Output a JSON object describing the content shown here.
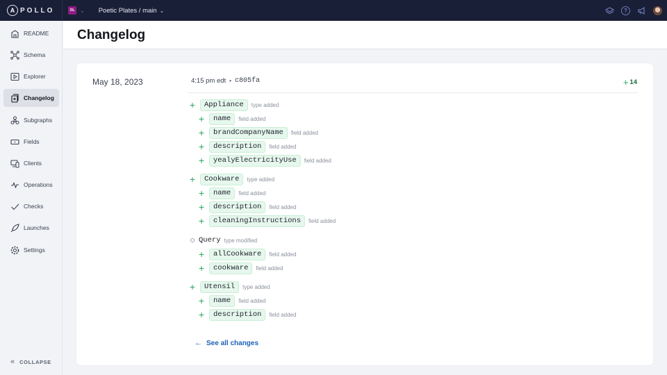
{
  "topbar": {
    "logo_letter": "A",
    "logo_text": "POLLO",
    "org_initials": "OL",
    "graph_name": "Poetic Plates / main",
    "icons": [
      "layers-icon",
      "help-icon",
      "megaphone-icon",
      "avatar"
    ]
  },
  "sidebar": {
    "items": [
      {
        "label": "README",
        "icon": "readme-icon",
        "active": false
      },
      {
        "label": "Schema",
        "icon": "schema-icon",
        "active": false
      },
      {
        "label": "Explorer",
        "icon": "explorer-icon",
        "active": false
      },
      {
        "label": "Changelog",
        "icon": "changelog-icon",
        "active": true
      },
      {
        "label": "Subgraphs",
        "icon": "subgraphs-icon",
        "active": false
      },
      {
        "label": "Fields",
        "icon": "fields-icon",
        "active": false
      },
      {
        "label": "Clients",
        "icon": "clients-icon",
        "active": false
      },
      {
        "label": "Operations",
        "icon": "operations-icon",
        "active": false
      },
      {
        "label": "Checks",
        "icon": "checks-icon",
        "active": false
      },
      {
        "label": "Launches",
        "icon": "launches-icon",
        "active": false
      },
      {
        "label": "Settings",
        "icon": "settings-icon",
        "active": false
      }
    ],
    "collapse_label": "COLLAPSE"
  },
  "page": {
    "title": "Changelog"
  },
  "changelog": {
    "date": "May 18, 2023",
    "time": "4:15 pm edt",
    "separator": "•",
    "commit": "c805fa",
    "change_count": "14",
    "changes": [
      {
        "level": 0,
        "kind": "added",
        "name": "Appliance",
        "label": "type added"
      },
      {
        "level": 1,
        "kind": "added",
        "name": "name",
        "label": "field added"
      },
      {
        "level": 1,
        "kind": "added",
        "name": "brandCompanyName",
        "label": "field added"
      },
      {
        "level": 1,
        "kind": "added",
        "name": "description",
        "label": "field added"
      },
      {
        "level": 1,
        "kind": "added",
        "name": "yealyElectricityUse",
        "label": "field added"
      },
      {
        "level": 0,
        "kind": "added",
        "name": "Cookware",
        "label": "type added"
      },
      {
        "level": 1,
        "kind": "added",
        "name": "name",
        "label": "field added"
      },
      {
        "level": 1,
        "kind": "added",
        "name": "description",
        "label": "field added"
      },
      {
        "level": 1,
        "kind": "added",
        "name": "cleaningInstructions",
        "label": "field added"
      },
      {
        "level": 0,
        "kind": "modified",
        "name": "Query",
        "label": "type modified"
      },
      {
        "level": 1,
        "kind": "added",
        "name": "allCookware",
        "label": "field added"
      },
      {
        "level": 1,
        "kind": "added",
        "name": "cookware",
        "label": "field added"
      },
      {
        "level": 0,
        "kind": "added",
        "name": "Utensil",
        "label": "type added"
      },
      {
        "level": 1,
        "kind": "added",
        "name": "name",
        "label": "field added"
      },
      {
        "level": 1,
        "kind": "added",
        "name": "description",
        "label": "field added"
      }
    ],
    "see_all_label": "See all changes"
  },
  "colors": {
    "topbar_bg": "#1a1f38",
    "added_green": "#2aa560",
    "pill_bg": "#e6f7ed",
    "link_blue": "#1b62b8",
    "org_badge": "#8e1c82"
  }
}
